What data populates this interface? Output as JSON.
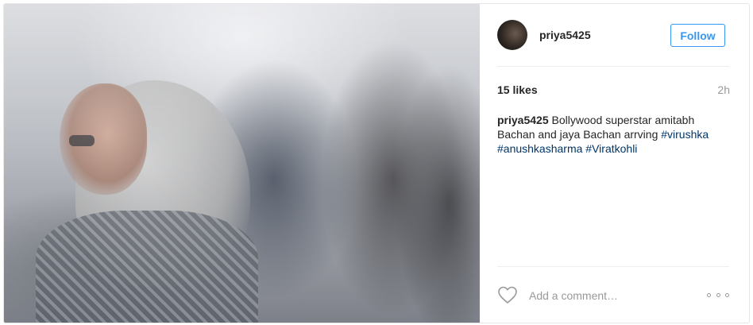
{
  "post": {
    "username": "priya5425",
    "follow_label": "Follow",
    "likes": "15 likes",
    "time": "2h",
    "caption": {
      "username": "priya5425",
      "text": "Bollywood superstar amitabh Bachan and jaya Bachan arrving",
      "hashtags": [
        "#virushka",
        "#anushkasharma",
        "#Viratkohli"
      ]
    },
    "comment_placeholder": "Add a comment…",
    "icons": {
      "like": "heart-icon",
      "more": "more-options-icon"
    },
    "colors": {
      "accent": "#3897f0",
      "hashtag": "#003569",
      "muted": "#999999",
      "text": "#262626"
    }
  }
}
